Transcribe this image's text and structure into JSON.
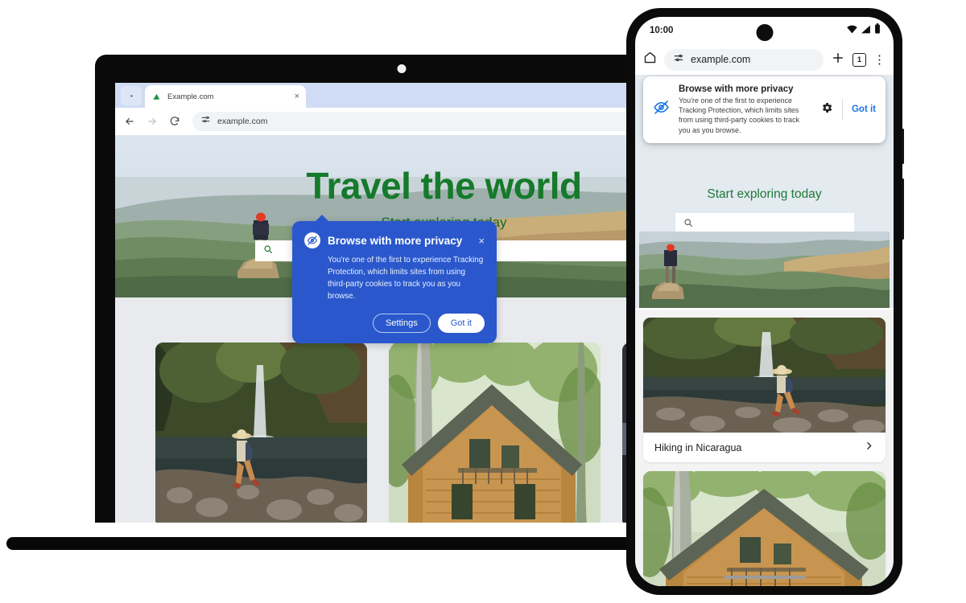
{
  "laptop": {
    "browser": {
      "tab": {
        "title": "Example.com",
        "favicon": "mountain-icon",
        "close": "×",
        "chevron": "⌄"
      },
      "nav": {
        "back": "←",
        "forward": "→",
        "reload": "↻"
      },
      "omnibox": {
        "value": "example.com",
        "site_settings_icon": "tune-icon"
      }
    },
    "page": {
      "hero_title": "Travel the world",
      "hero_subtitle": "Start exploring today",
      "search_placeholder": "",
      "search_icon": "search-icon",
      "carousel": {
        "prev": "‹",
        "next": "›"
      },
      "cards": [
        {
          "name": "waterfall-hiker-photo"
        },
        {
          "name": "log-cabin-photo"
        },
        {
          "name": "third-photo"
        }
      ]
    },
    "dialog": {
      "icon": "eye-off-icon",
      "title": "Browse with more privacy",
      "body": "You're one of the first to experience Tracking Protection, which limits sites from using third-party cookies to track you as you browse.",
      "close": "×",
      "settings_label": "Settings",
      "gotit_label": "Got it"
    }
  },
  "phone": {
    "status": {
      "time": "10:00",
      "wifi": "wifi-icon",
      "signal": "signal-icon",
      "battery": "battery-icon"
    },
    "toolbar": {
      "home_icon": "home-icon",
      "site_settings_icon": "tune-icon",
      "url": "example.com",
      "new_tab": "+",
      "tab_count": "1",
      "overflow": "⋮"
    },
    "privacy_card": {
      "icon": "eye-off-icon",
      "title": "Browse with more privacy",
      "body": "You're one of the first to experience Tracking Protection, which limits sites from using third-party cookies to track you as you browse.",
      "settings_icon": "gear-icon",
      "gotit_label": "Got it"
    },
    "page": {
      "hero_subtitle": "Start exploring today",
      "search_icon": "search-icon",
      "cards": [
        {
          "label": "Hiking in Nicaragua",
          "chevron": "›",
          "image": "waterfall-hiker-photo"
        },
        {
          "label": "",
          "chevron": "",
          "image": "log-cabin-photo"
        }
      ]
    }
  },
  "colors": {
    "brand_green": "#157a2b",
    "dialog_blue": "#2a58cc",
    "link_blue": "#1a73e8",
    "carousel_next": "#137333",
    "carousel_prev": "#bdc1c6"
  }
}
